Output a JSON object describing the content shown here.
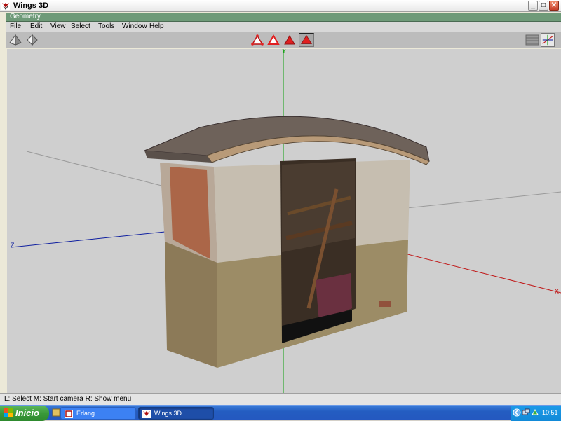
{
  "window": {
    "title": "Wings 3D",
    "controls": {
      "minimize": "_",
      "maximize": "□",
      "close": "✕"
    }
  },
  "geometry_header": {
    "label": "Geometry"
  },
  "menubar": {
    "items": [
      "File",
      "Edit",
      "View",
      "Select",
      "Tools",
      "Window",
      "Help"
    ]
  },
  "toolbar": {
    "left_icons": [
      "perspective-view-icon",
      "orthographic-view-icon"
    ],
    "selection_modes": [
      "vertex-mode-icon",
      "edge-mode-icon",
      "face-mode-icon",
      "body-mode-icon"
    ],
    "active_selection_mode": "body",
    "right_icons": [
      "wireframe-toggle-icon",
      "smooth-shading-icon"
    ],
    "accent_color": "#e02020"
  },
  "viewport": {
    "axes": {
      "x_label": "X",
      "y_label": "Y",
      "z_label": "Z"
    },
    "axis_colors": {
      "x": "#c01818",
      "y": "#10a010",
      "z": "#1020a0"
    },
    "background": "#cfcfcf",
    "model": "textured-shed"
  },
  "statusbar": {
    "text": "L: Select   M: Start camera   R: Show menu"
  },
  "taskbar": {
    "start_label": "Inicio",
    "tasks": [
      {
        "label": "Erlang",
        "active": false
      },
      {
        "label": "Wings 3D",
        "active": true
      }
    ],
    "clock": "10:51"
  }
}
